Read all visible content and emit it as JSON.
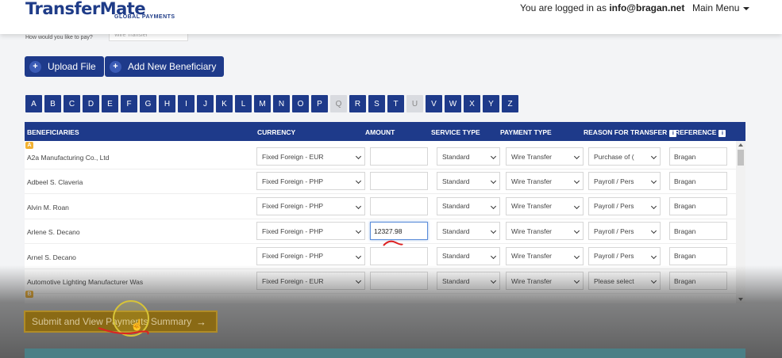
{
  "header": {
    "logo_main": "TransferMate",
    "logo_sub": "GLOBAL PAYMENTS",
    "login_prefix": "You are logged in as ",
    "login_email": "info@bragan.net",
    "menu_label": "Main Menu"
  },
  "payment_method": {
    "question": "How would you like to pay?",
    "selected": "Wire Transfer"
  },
  "actions": {
    "upload": "Upload File",
    "add_beneficiary": "Add New Beneficiary",
    "submit": "Submit and View Payments Summary"
  },
  "alphabet": [
    {
      "l": "A",
      "on": true
    },
    {
      "l": "B",
      "on": true
    },
    {
      "l": "C",
      "on": true
    },
    {
      "l": "D",
      "on": true
    },
    {
      "l": "E",
      "on": true
    },
    {
      "l": "F",
      "on": true
    },
    {
      "l": "G",
      "on": true
    },
    {
      "l": "H",
      "on": true
    },
    {
      "l": "I",
      "on": true
    },
    {
      "l": "J",
      "on": true
    },
    {
      "l": "K",
      "on": true
    },
    {
      "l": "L",
      "on": true
    },
    {
      "l": "M",
      "on": true
    },
    {
      "l": "N",
      "on": true
    },
    {
      "l": "O",
      "on": true
    },
    {
      "l": "P",
      "on": true
    },
    {
      "l": "Q",
      "on": false
    },
    {
      "l": "R",
      "on": true
    },
    {
      "l": "S",
      "on": true
    },
    {
      "l": "T",
      "on": true
    },
    {
      "l": "U",
      "on": false
    },
    {
      "l": "V",
      "on": true
    },
    {
      "l": "W",
      "on": true
    },
    {
      "l": "X",
      "on": true
    },
    {
      "l": "Y",
      "on": true
    },
    {
      "l": "Z",
      "on": true
    }
  ],
  "table": {
    "headers": {
      "beneficiaries": "BENEFICIARIES",
      "currency": "CURRENCY",
      "amount": "AMOUNT",
      "service_type": "SERVICE TYPE",
      "payment_type": "PAYMENT TYPE",
      "reason": "REASON FOR TRANSFER",
      "reference": "REFERENCE"
    },
    "groups": [
      "A",
      "B"
    ],
    "rows": [
      {
        "name": "A2a Manufacturing Co., Ltd",
        "currency": "Fixed Foreign - EUR",
        "amount": "",
        "service": "Standard",
        "payment": "Wire Transfer",
        "reason": "Purchase of (",
        "reference": "Bragan"
      },
      {
        "name": "Adbeel S. Claveria",
        "currency": "Fixed Foreign - PHP",
        "amount": "",
        "service": "Standard",
        "payment": "Wire Transfer",
        "reason": "Payroll / Pers",
        "reference": "Bragan"
      },
      {
        "name": "Alvin M. Roan",
        "currency": "Fixed Foreign - PHP",
        "amount": "",
        "service": "Standard",
        "payment": "Wire Transfer",
        "reason": "Payroll / Pers",
        "reference": "Bragan"
      },
      {
        "name": "Arlene S. Decano",
        "currency": "Fixed Foreign - PHP",
        "amount": "12327.98",
        "service": "Standard",
        "payment": "Wire Transfer",
        "reason": "Payroll / Pers",
        "reference": "Bragan"
      },
      {
        "name": "Arnel S. Decano",
        "currency": "Fixed Foreign - PHP",
        "amount": "",
        "service": "Standard",
        "payment": "Wire Transfer",
        "reason": "Payroll / Pers",
        "reference": "Bragan"
      },
      {
        "name": "Automotive Lighting Manufacturer Was",
        "currency": "Fixed Foreign - EUR",
        "amount": "",
        "service": "Standard",
        "payment": "Wire Transfer",
        "reason": "Please select",
        "reference": "Bragan"
      }
    ]
  },
  "colors": {
    "brand": "#1e3a8a",
    "group_badge": "#f2b233",
    "submit": "#8a6a15"
  }
}
